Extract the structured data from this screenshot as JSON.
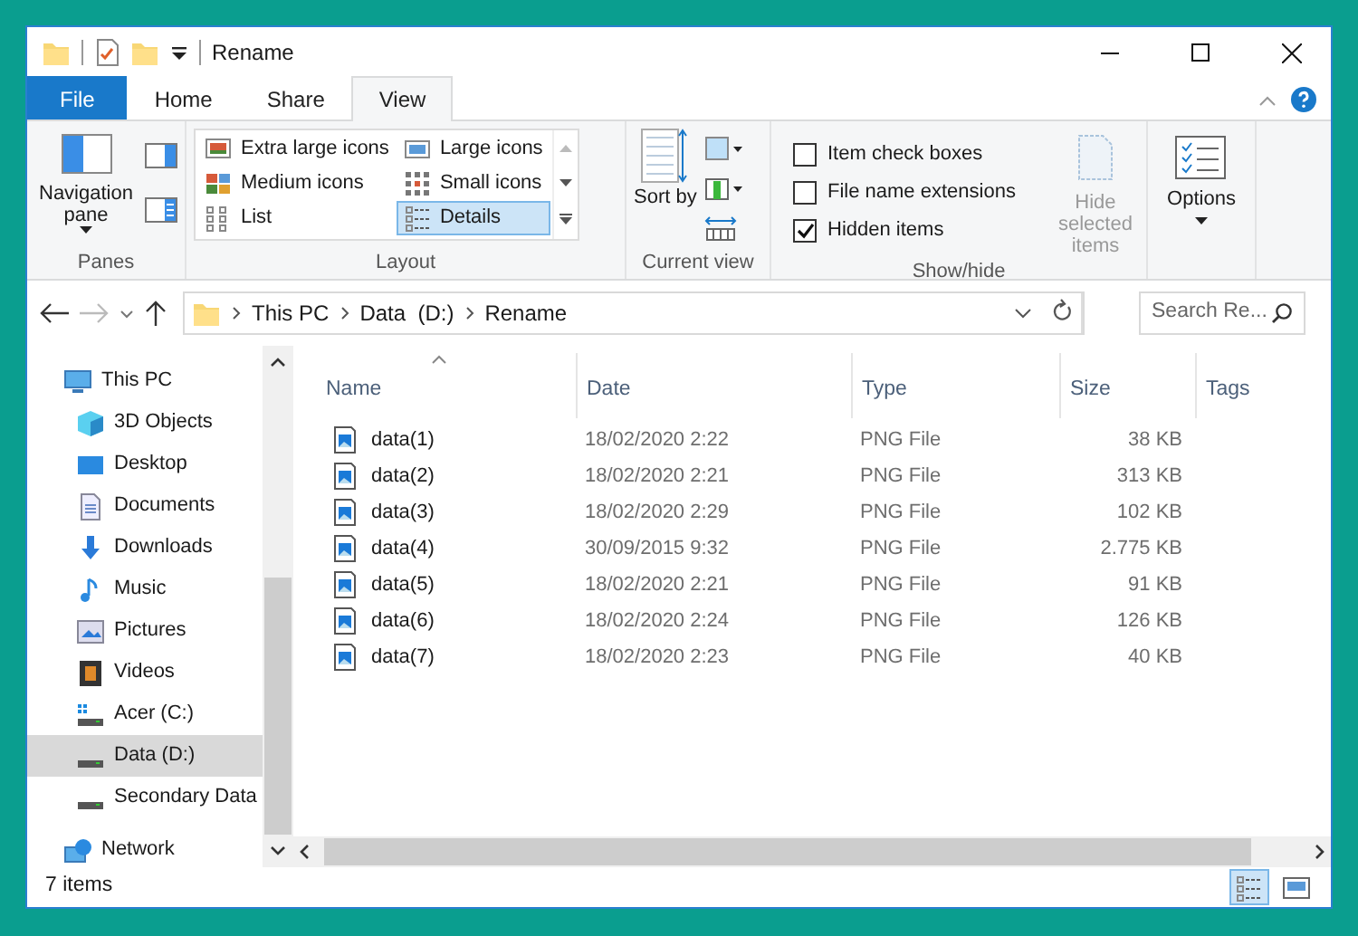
{
  "window": {
    "title": "Rename"
  },
  "ribbon_tabs": [
    {
      "label": "File",
      "kind": "file",
      "selected": false
    },
    {
      "label": "Home",
      "kind": "tab",
      "selected": false
    },
    {
      "label": "Share",
      "kind": "tab",
      "selected": false
    },
    {
      "label": "View",
      "kind": "tab",
      "selected": true
    }
  ],
  "panes_group": {
    "label": "Panes",
    "navigation_pane": "Navigation pane"
  },
  "layout_group": {
    "label": "Layout",
    "options": [
      {
        "label": "Extra large icons",
        "kind": "xl",
        "selected": false
      },
      {
        "label": "Large icons",
        "kind": "large",
        "selected": false
      },
      {
        "label": "Medium icons",
        "kind": "medium",
        "selected": false
      },
      {
        "label": "Small icons",
        "kind": "small",
        "selected": false
      },
      {
        "label": "List",
        "kind": "list",
        "selected": false
      },
      {
        "label": "Details",
        "kind": "details",
        "selected": true
      }
    ]
  },
  "current_view_group": {
    "label": "Current view",
    "sort_by": "Sort by"
  },
  "show_hide_group": {
    "label": "Show/hide",
    "checkboxes": [
      {
        "label": "Item check boxes",
        "checked": false
      },
      {
        "label": "File name extensions",
        "checked": false
      },
      {
        "label": "Hidden items",
        "checked": true
      }
    ],
    "hide_selected": {
      "label": "Hide selected items",
      "disabled": true
    }
  },
  "options_button": "Options",
  "address_bar": {
    "path": [
      "This PC",
      "Data  (D:)",
      "Rename"
    ]
  },
  "search": {
    "placeholder": "Search Re..."
  },
  "navigation": {
    "items": [
      {
        "label": "This PC",
        "kind": "pc",
        "selected": false,
        "children": [
          {
            "label": "3D Objects",
            "kind": "cube",
            "selected": false
          },
          {
            "label": "Desktop",
            "kind": "desktop",
            "selected": false
          },
          {
            "label": "Documents",
            "kind": "documents",
            "selected": false
          },
          {
            "label": "Downloads",
            "kind": "downloads",
            "selected": false
          },
          {
            "label": "Music",
            "kind": "music",
            "selected": false
          },
          {
            "label": "Pictures",
            "kind": "pictures",
            "selected": false
          },
          {
            "label": "Videos",
            "kind": "videos",
            "selected": false
          },
          {
            "label": "Acer (C:)",
            "kind": "system-drive",
            "selected": false
          },
          {
            "label": "Data  (D:)",
            "kind": "drive",
            "selected": true
          },
          {
            "label": "Secondary Data",
            "kind": "drive",
            "selected": false
          }
        ]
      },
      {
        "label": "Network",
        "kind": "network",
        "selected": false
      }
    ]
  },
  "table": {
    "columns": [
      {
        "label": "Name",
        "sorted": true
      },
      {
        "label": "Date",
        "sorted": false
      },
      {
        "label": "Type",
        "sorted": false
      },
      {
        "label": "Size",
        "sorted": false
      },
      {
        "label": "Tags",
        "sorted": false
      }
    ],
    "rows": [
      {
        "name": "data(1)",
        "date": "18/02/2020 2:22",
        "type": "PNG File",
        "size": "38 KB"
      },
      {
        "name": "data(2)",
        "date": "18/02/2020 2:21",
        "type": "PNG File",
        "size": "313 KB"
      },
      {
        "name": "data(3)",
        "date": "18/02/2020 2:29",
        "type": "PNG File",
        "size": "102 KB"
      },
      {
        "name": "data(4)",
        "date": "30/09/2015 9:32",
        "type": "PNG File",
        "size": "2.775 KB"
      },
      {
        "name": "data(5)",
        "date": "18/02/2020 2:21",
        "type": "PNG File",
        "size": "91 KB"
      },
      {
        "name": "data(6)",
        "date": "18/02/2020 2:24",
        "type": "PNG File",
        "size": "126 KB"
      },
      {
        "name": "data(7)",
        "date": "18/02/2020 2:23",
        "type": "PNG File",
        "size": "40 KB"
      }
    ]
  },
  "status_bar": {
    "item_count": "7 items",
    "view_buttons": [
      {
        "kind": "details",
        "selected": true
      },
      {
        "kind": "large",
        "selected": false
      }
    ]
  }
}
